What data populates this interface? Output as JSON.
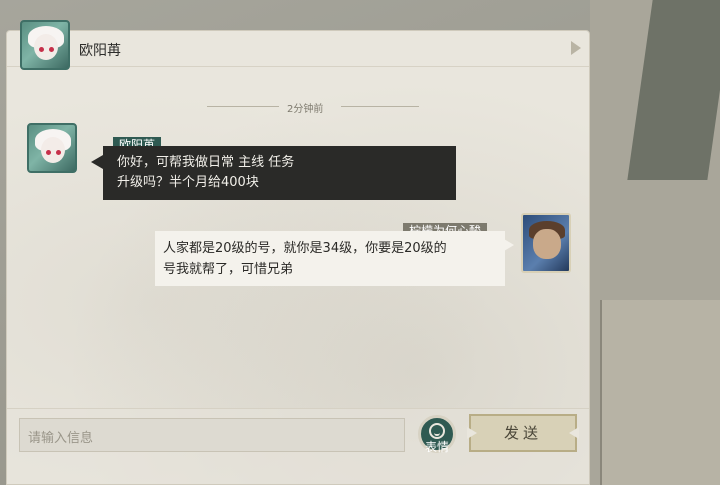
{
  "header": {
    "title": "欧阳苒"
  },
  "chat": {
    "timestamp": "2分钟前",
    "messages": [
      {
        "sender": "欧阳苒",
        "side": "left",
        "line1": "你好，可帮我做日常 主线 任务",
        "line2": "升级吗？半个月给400块"
      },
      {
        "sender": "柠檬为何心酸",
        "side": "right",
        "line1": "人家都是20级的号，就你是34级，你要是20级的",
        "line2": "号我就帮了，可惜兄弟"
      }
    ]
  },
  "composer": {
    "placeholder": "请输入信息",
    "emoji_label": "表情",
    "send_label": "发送"
  },
  "colors": {
    "accent_green": "#2f5a52",
    "bubble_dark": "#2a2a28",
    "bubble_light": "#f4f2ec"
  }
}
